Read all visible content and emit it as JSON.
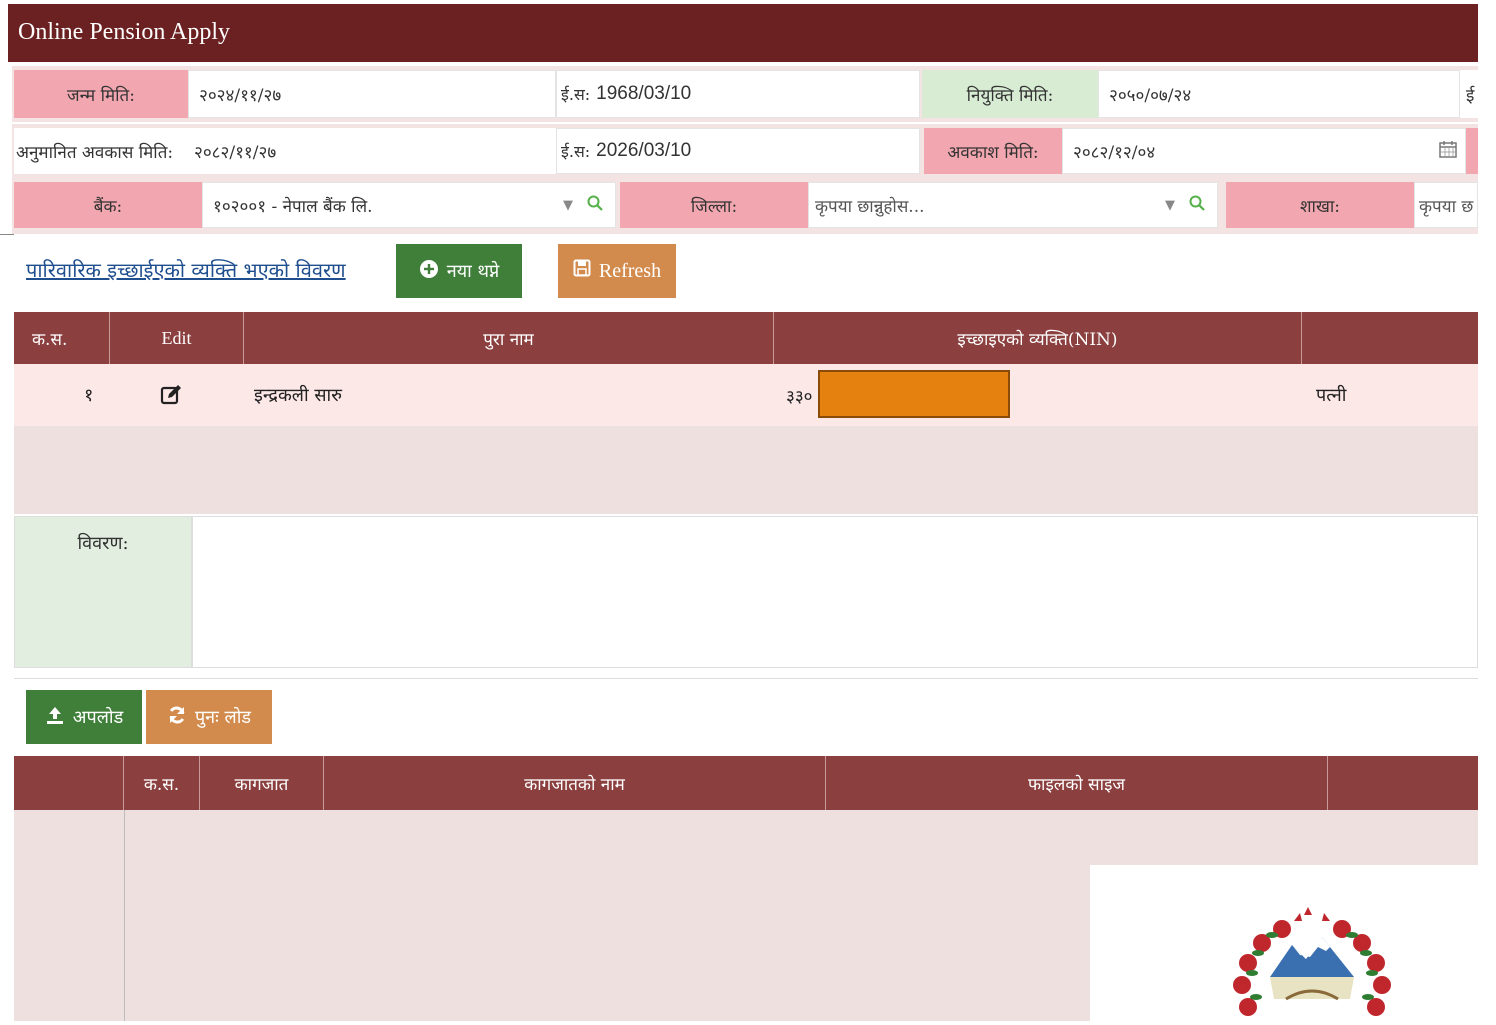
{
  "app": {
    "title": "Online Pension Apply"
  },
  "form": {
    "row1": {
      "dob_label": "जन्म मिति:",
      "dob_bs": "२०२४/११/२७",
      "dob_ad_label": "ई.स:",
      "dob_ad": "1968/03/10",
      "appoint_label": "नियुक्ति मिति:",
      "appoint_bs": "२०५०/०७/२४",
      "appoint_ad_label": "ई"
    },
    "row2": {
      "est_retire_label": "अनुमानित अवकास मिति:",
      "est_retire_bs": "२०८२/११/२७",
      "est_retire_ad_label": "ई.स:",
      "est_retire_ad": "2026/03/10",
      "retire_label": "अवकाश मिति:",
      "retire_bs": "२०८२/१२/०४"
    },
    "row3": {
      "bank_label": "बैंक:",
      "bank_value": "१०२००१ - नेपाल बैंक लि.",
      "district_label": "जिल्ला:",
      "district_placeholder": "कृपया छान्नुहोस...",
      "branch_label": "शाखा:",
      "branch_placeholder": "कृपया छ"
    }
  },
  "family": {
    "link": "पारिवारिक इच्छाईएको व्यक्ति भएको विवरण",
    "add_button": "नया थप्ने",
    "refresh_button": "Refresh",
    "columns": [
      "क.स.",
      "Edit",
      "पुरा नाम",
      "इच्छाइएको व्यक्ति(NIN)",
      ""
    ],
    "rows": [
      {
        "sn": "१",
        "name": "इन्द्रकली सारु",
        "nin_prefix": "३३०",
        "relation": "पत्नी"
      }
    ]
  },
  "details": {
    "label": "विवरण:",
    "value": ""
  },
  "docs": {
    "upload_button": "अपलोड",
    "reload_button": "पुनः लोड",
    "columns": [
      "",
      "क.स.",
      "कागजात",
      "कागजातको नाम",
      "फाइलको साइज",
      ""
    ]
  },
  "icons": {
    "calendar": "calendar-icon",
    "caret": "caret-down-icon",
    "search": "search-icon",
    "plus": "plus-circle-icon",
    "save": "floppy-icon",
    "edit": "edit-icon",
    "upload": "upload-icon",
    "reload": "refresh-icon",
    "emblem": "nepal-emblem-icon"
  },
  "colors": {
    "titlebar": "#6b2121",
    "label_bg": "#f2a7b0",
    "table_header": "#8b3f3f",
    "button_green": "#3f7f3a",
    "button_orange": "#d28b4c",
    "redaction": "#e5820f"
  }
}
